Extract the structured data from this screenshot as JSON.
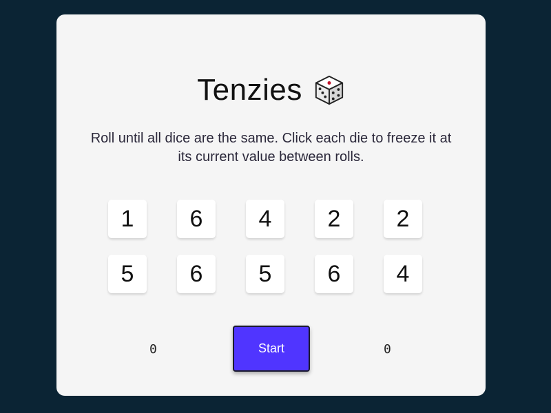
{
  "game": {
    "title": "Tenzies",
    "title_icon": "dice-icon",
    "instructions": "Roll until all dice are the same. Click each die to freeze it at its current value between rolls."
  },
  "dice": [
    {
      "value": "1"
    },
    {
      "value": "6"
    },
    {
      "value": "4"
    },
    {
      "value": "2"
    },
    {
      "value": "2"
    },
    {
      "value": "5"
    },
    {
      "value": "6"
    },
    {
      "value": "5"
    },
    {
      "value": "6"
    },
    {
      "value": "4"
    }
  ],
  "controls": {
    "start_label": "Start",
    "left_counter": "0",
    "right_counter": "0"
  },
  "colors": {
    "background": "#0b2434",
    "card": "#f5f5f5",
    "button": "#5035ff",
    "die": "#ffffff",
    "pip_accent": "#c0142b"
  }
}
